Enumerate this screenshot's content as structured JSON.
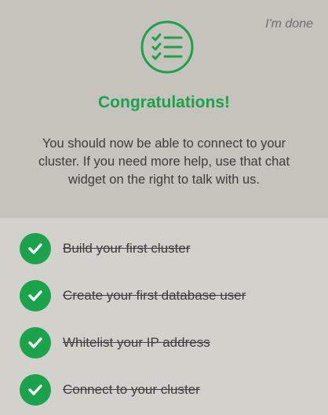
{
  "header": {
    "done_label": "I'm done",
    "logo_icon": "checklist-icon",
    "title": "Congratulations!",
    "message": "You should now be able to connect to your cluster. If you need more help, use that chat widget on the right to talk with us."
  },
  "steps": [
    {
      "label": "Build your first cluster",
      "status": "completed"
    },
    {
      "label": "Create your first database user",
      "status": "completed"
    },
    {
      "label": "Whitelist your IP address",
      "status": "completed"
    },
    {
      "label": "Connect to your cluster",
      "status": "completed"
    }
  ],
  "colors": {
    "accent": "#1aa34a",
    "header_bg": "#c6c2bc",
    "list_bg": "#d3d1cc",
    "text": "#3d3d3d"
  }
}
